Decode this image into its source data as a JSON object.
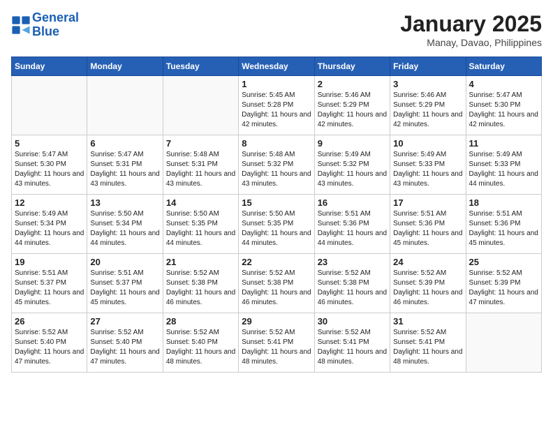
{
  "header": {
    "logo_line1": "General",
    "logo_line2": "Blue",
    "month": "January 2025",
    "location": "Manay, Davao, Philippines"
  },
  "weekdays": [
    "Sunday",
    "Monday",
    "Tuesday",
    "Wednesday",
    "Thursday",
    "Friday",
    "Saturday"
  ],
  "weeks": [
    [
      {
        "day": "",
        "info": ""
      },
      {
        "day": "",
        "info": ""
      },
      {
        "day": "",
        "info": ""
      },
      {
        "day": "1",
        "sunrise": "5:45 AM",
        "sunset": "5:28 PM",
        "daylight": "11 hours and 42 minutes."
      },
      {
        "day": "2",
        "sunrise": "5:46 AM",
        "sunset": "5:29 PM",
        "daylight": "11 hours and 42 minutes."
      },
      {
        "day": "3",
        "sunrise": "5:46 AM",
        "sunset": "5:29 PM",
        "daylight": "11 hours and 42 minutes."
      },
      {
        "day": "4",
        "sunrise": "5:47 AM",
        "sunset": "5:30 PM",
        "daylight": "11 hours and 42 minutes."
      }
    ],
    [
      {
        "day": "5",
        "sunrise": "5:47 AM",
        "sunset": "5:30 PM",
        "daylight": "11 hours and 43 minutes."
      },
      {
        "day": "6",
        "sunrise": "5:47 AM",
        "sunset": "5:31 PM",
        "daylight": "11 hours and 43 minutes."
      },
      {
        "day": "7",
        "sunrise": "5:48 AM",
        "sunset": "5:31 PM",
        "daylight": "11 hours and 43 minutes."
      },
      {
        "day": "8",
        "sunrise": "5:48 AM",
        "sunset": "5:32 PM",
        "daylight": "11 hours and 43 minutes."
      },
      {
        "day": "9",
        "sunrise": "5:49 AM",
        "sunset": "5:32 PM",
        "daylight": "11 hours and 43 minutes."
      },
      {
        "day": "10",
        "sunrise": "5:49 AM",
        "sunset": "5:33 PM",
        "daylight": "11 hours and 43 minutes."
      },
      {
        "day": "11",
        "sunrise": "5:49 AM",
        "sunset": "5:33 PM",
        "daylight": "11 hours and 44 minutes."
      }
    ],
    [
      {
        "day": "12",
        "sunrise": "5:49 AM",
        "sunset": "5:34 PM",
        "daylight": "11 hours and 44 minutes."
      },
      {
        "day": "13",
        "sunrise": "5:50 AM",
        "sunset": "5:34 PM",
        "daylight": "11 hours and 44 minutes."
      },
      {
        "day": "14",
        "sunrise": "5:50 AM",
        "sunset": "5:35 PM",
        "daylight": "11 hours and 44 minutes."
      },
      {
        "day": "15",
        "sunrise": "5:50 AM",
        "sunset": "5:35 PM",
        "daylight": "11 hours and 44 minutes."
      },
      {
        "day": "16",
        "sunrise": "5:51 AM",
        "sunset": "5:36 PM",
        "daylight": "11 hours and 44 minutes."
      },
      {
        "day": "17",
        "sunrise": "5:51 AM",
        "sunset": "5:36 PM",
        "daylight": "11 hours and 45 minutes."
      },
      {
        "day": "18",
        "sunrise": "5:51 AM",
        "sunset": "5:36 PM",
        "daylight": "11 hours and 45 minutes."
      }
    ],
    [
      {
        "day": "19",
        "sunrise": "5:51 AM",
        "sunset": "5:37 PM",
        "daylight": "11 hours and 45 minutes."
      },
      {
        "day": "20",
        "sunrise": "5:51 AM",
        "sunset": "5:37 PM",
        "daylight": "11 hours and 45 minutes."
      },
      {
        "day": "21",
        "sunrise": "5:52 AM",
        "sunset": "5:38 PM",
        "daylight": "11 hours and 46 minutes."
      },
      {
        "day": "22",
        "sunrise": "5:52 AM",
        "sunset": "5:38 PM",
        "daylight": "11 hours and 46 minutes."
      },
      {
        "day": "23",
        "sunrise": "5:52 AM",
        "sunset": "5:38 PM",
        "daylight": "11 hours and 46 minutes."
      },
      {
        "day": "24",
        "sunrise": "5:52 AM",
        "sunset": "5:39 PM",
        "daylight": "11 hours and 46 minutes."
      },
      {
        "day": "25",
        "sunrise": "5:52 AM",
        "sunset": "5:39 PM",
        "daylight": "11 hours and 47 minutes."
      }
    ],
    [
      {
        "day": "26",
        "sunrise": "5:52 AM",
        "sunset": "5:40 PM",
        "daylight": "11 hours and 47 minutes."
      },
      {
        "day": "27",
        "sunrise": "5:52 AM",
        "sunset": "5:40 PM",
        "daylight": "11 hours and 47 minutes."
      },
      {
        "day": "28",
        "sunrise": "5:52 AM",
        "sunset": "5:40 PM",
        "daylight": "11 hours and 48 minutes."
      },
      {
        "day": "29",
        "sunrise": "5:52 AM",
        "sunset": "5:41 PM",
        "daylight": "11 hours and 48 minutes."
      },
      {
        "day": "30",
        "sunrise": "5:52 AM",
        "sunset": "5:41 PM",
        "daylight": "11 hours and 48 minutes."
      },
      {
        "day": "31",
        "sunrise": "5:52 AM",
        "sunset": "5:41 PM",
        "daylight": "11 hours and 48 minutes."
      },
      {
        "day": "",
        "info": ""
      }
    ]
  ],
  "labels": {
    "sunrise": "Sunrise:",
    "sunset": "Sunset:",
    "daylight": "Daylight:"
  }
}
